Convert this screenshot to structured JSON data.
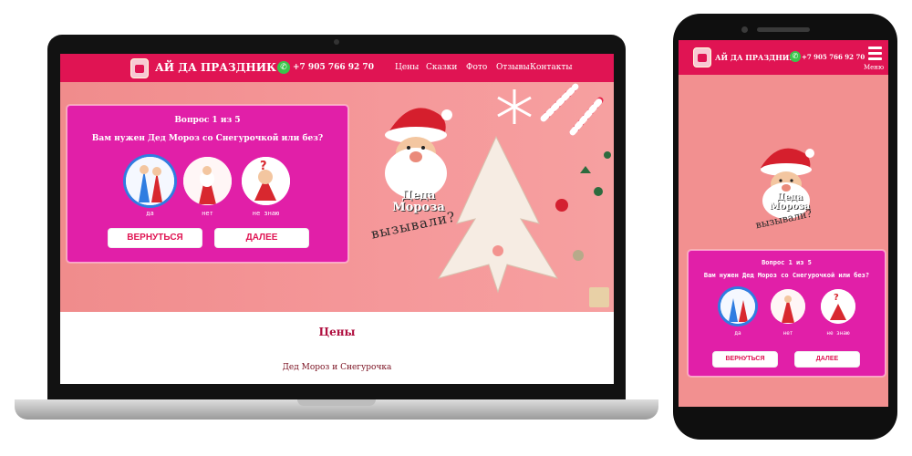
{
  "brand": {
    "name": "АЙ ДА ПРАЗДНИК"
  },
  "header": {
    "phone": "+7 905 766 92 70",
    "nav_items": [
      "Цены",
      "Сказки",
      "Фото",
      "Отзывы",
      "Контакты"
    ],
    "menu_label": "Меню"
  },
  "hero": {
    "slogan_line1": "Деда",
    "slogan_line2": "Мороза",
    "slogan_line3": "вызывали?"
  },
  "quiz": {
    "progress": "Вопрос 1 из 5",
    "question": "Вам нужен Дед Мороз со Снегурочкой или без?",
    "options": [
      {
        "label": "да",
        "selected": true
      },
      {
        "label": "нет",
        "selected": false
      },
      {
        "label": "не знаю",
        "selected": false
      }
    ],
    "back_label": "ВЕРНУТЬСЯ",
    "next_label": "ДАЛЕЕ"
  },
  "prices": {
    "title": "Цены",
    "item": "Дед Мороз и Снегурочка"
  },
  "colors": {
    "header": "#e01453",
    "quiz_bg": "#e11fa8",
    "hero_bg": "#f3938f",
    "whatsapp": "#3bc44b"
  }
}
